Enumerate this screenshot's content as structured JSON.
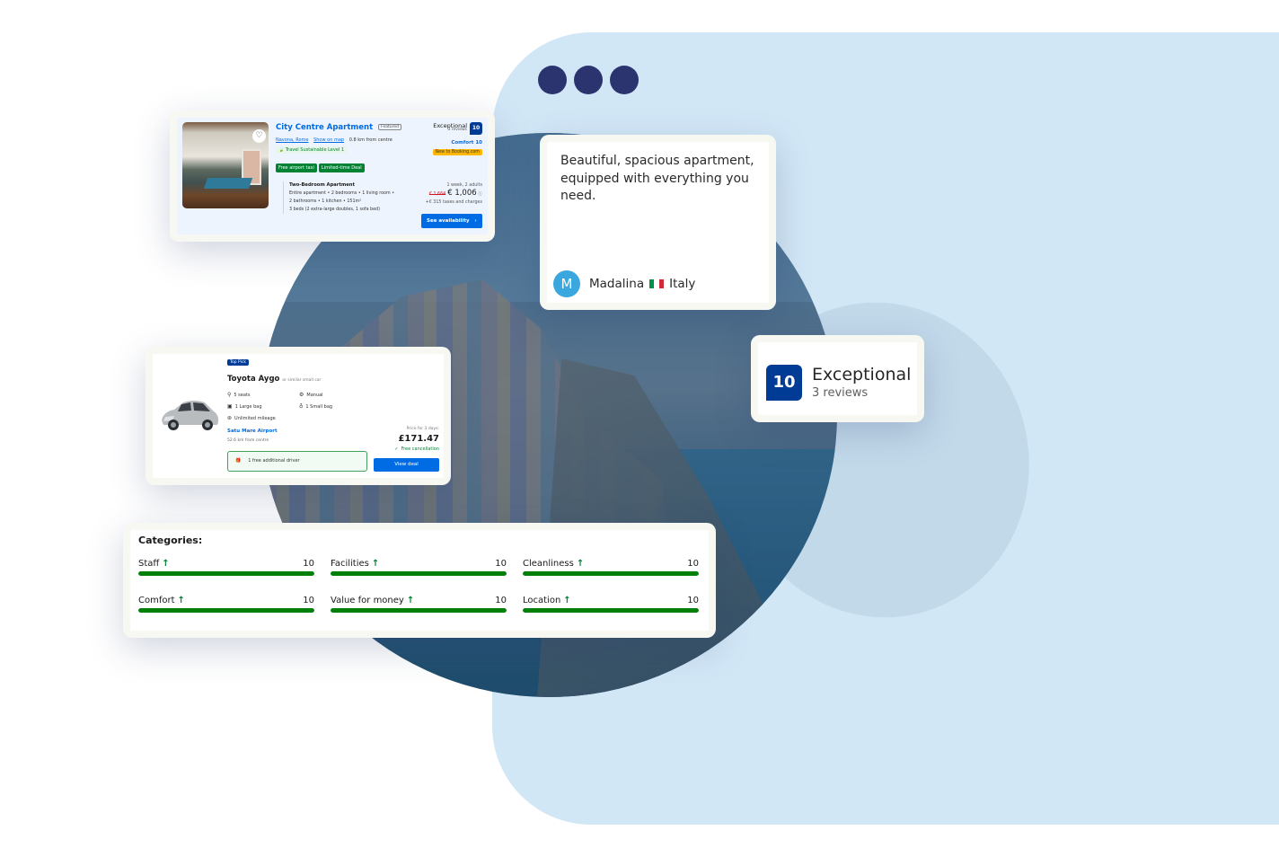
{
  "decor": {
    "window_dots": 3,
    "colors": {
      "panel": "#d2e7f6",
      "dots": "#2c3470",
      "brand_blue": "#003b95",
      "link_blue": "#006ce4",
      "green": "#008009",
      "yellow": "#ffb700"
    }
  },
  "hotel_card": {
    "title": "City Centre Apartment",
    "featured_label": "Featured",
    "location_link": "Navona, Rome",
    "map_link": "Show on map",
    "distance": "0.8 km from centre",
    "sustainability": "Travel Sustainable Level 1",
    "tags": [
      "Free airport taxi",
      "Limited-time Deal"
    ],
    "room_name": "Two-Bedroom Apartment",
    "room_details": [
      "Entire apartment • 2 bedrooms • 1 living room •",
      "2 bathrooms • 1 kitchen • 151m²",
      "3 beds (2 extra-large doubles, 1 sofa bed)"
    ],
    "rating_label": "Exceptional",
    "reviews": "3 reviews",
    "score": "10",
    "comfort": "Comfort 10",
    "new_badge": "New to Booking.com",
    "stay": "1 week, 2 adults",
    "old_price": "€ 1,664",
    "price": "€ 1,006",
    "taxes": "+€ 315 taxes and charges",
    "cta": "See availability",
    "heart_icon": "♡"
  },
  "review_card": {
    "text": "Beautiful, spacious apartment, equipped with everything you need.",
    "avatar_initial": "M",
    "name": "Madalina",
    "country": "Italy",
    "flag_colors": [
      "#009246",
      "#ffffff",
      "#ce2b37"
    ]
  },
  "score_card": {
    "score": "10",
    "label": "Exceptional",
    "reviews": "3 reviews"
  },
  "car_card": {
    "badge": "Top Pick",
    "model": "Toyota Aygo",
    "model_note": "or similar small car",
    "features": [
      {
        "icon": "person-icon",
        "glyph": "👤",
        "label": "5 seats"
      },
      {
        "icon": "gear-shift-icon",
        "glyph": "⚙",
        "label": "Manual"
      },
      {
        "icon": "suitcase-icon",
        "glyph": "🧳",
        "label": "1 Large bag"
      },
      {
        "icon": "bag-icon",
        "glyph": "👜",
        "label": "1 Small bag"
      },
      {
        "icon": "speedometer-icon",
        "glyph": "⊛",
        "label": "Unlimited mileage"
      }
    ],
    "pickup": "Satu Mare Airport",
    "pickup_distance": "52.6 km from centre",
    "extra": "1 free additional driver",
    "price_title": "Price for 3 days:",
    "price": "£171.47",
    "cancellation": "Free cancellation",
    "cta": "View deal"
  },
  "categories_card": {
    "title": "Categories:",
    "items": [
      {
        "label": "Staff",
        "score": "10",
        "fraction": 1.0
      },
      {
        "label": "Facilities",
        "score": "10",
        "fraction": 1.0
      },
      {
        "label": "Cleanliness",
        "score": "10",
        "fraction": 1.0
      },
      {
        "label": "Comfort",
        "score": "10",
        "fraction": 1.0
      },
      {
        "label": "Value for money",
        "score": "10",
        "fraction": 1.0
      },
      {
        "label": "Location",
        "score": "10",
        "fraction": 1.0
      }
    ]
  }
}
